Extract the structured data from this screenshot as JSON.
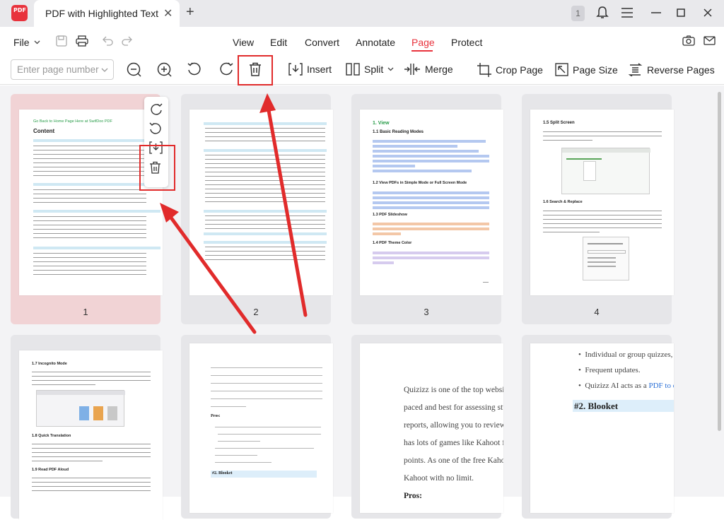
{
  "titlebar": {
    "logo_text": "PDF",
    "tab_title": "PDF with Highlighted Text",
    "tab_close": "✕",
    "new_tab": "+",
    "badge": "1"
  },
  "menubar": {
    "file_label": "File",
    "items": [
      "View",
      "Edit",
      "Convert",
      "Annotate",
      "Page",
      "Protect"
    ],
    "active": "Page"
  },
  "toolbar": {
    "page_input_placeholder": "Enter page number",
    "insert_label": "Insert",
    "split_label": "Split",
    "merge_label": "Merge",
    "crop_label": "Crop Page",
    "page_size_label": "Page Size",
    "reverse_label": "Reverse Pages"
  },
  "colors": {
    "accent": "#e8323c",
    "annotation": "#e12b2b",
    "selected_card": "#f1d3d5"
  },
  "pages": [
    {
      "number": "1"
    },
    {
      "number": "2"
    },
    {
      "number": "3"
    },
    {
      "number": "4"
    }
  ],
  "page1": {
    "title_link": "Go Back to Home Page Here at SwifDoo PDF",
    "heading": "Content"
  },
  "page3": {
    "h1": "1. View",
    "h2a": "1.1 Basic Reading Modes",
    "h2b": "1.2 View PDFs in Simple Mode or Full Screen Mode",
    "h2c": "1.3 PDF Slideshow",
    "h2d": "1.4 PDF Theme Color"
  },
  "page4": {
    "h2a": "1.5 Split Screen",
    "h2b": "1.6 Search & Replace"
  },
  "page5": {
    "h2a": "1.7 Incognito Mode",
    "h2b": "1.8 Quick Translation",
    "h2c": "1.9 Read PDF Aloud"
  },
  "page6": {
    "pros": "Pros:",
    "blooket": "#2. Blooket"
  },
  "page7": {
    "lines": [
      "Quizizz is one of the top websites sir",
      "paced and best for assessing student",
      "reports, allowing you to review the r",
      "has lots of games like Kahoot for use",
      "points. As one of the free Kahoot alte",
      "Kahoot with no limit."
    ],
    "pros": "Pros:"
  },
  "page8": {
    "bullets": [
      "Individual or group quizzes, assig",
      "Frequent updates.",
      "Quizizz AI acts as a "
    ],
    "link": "PDF to quiz m",
    "heading": "#2. Blooket"
  }
}
